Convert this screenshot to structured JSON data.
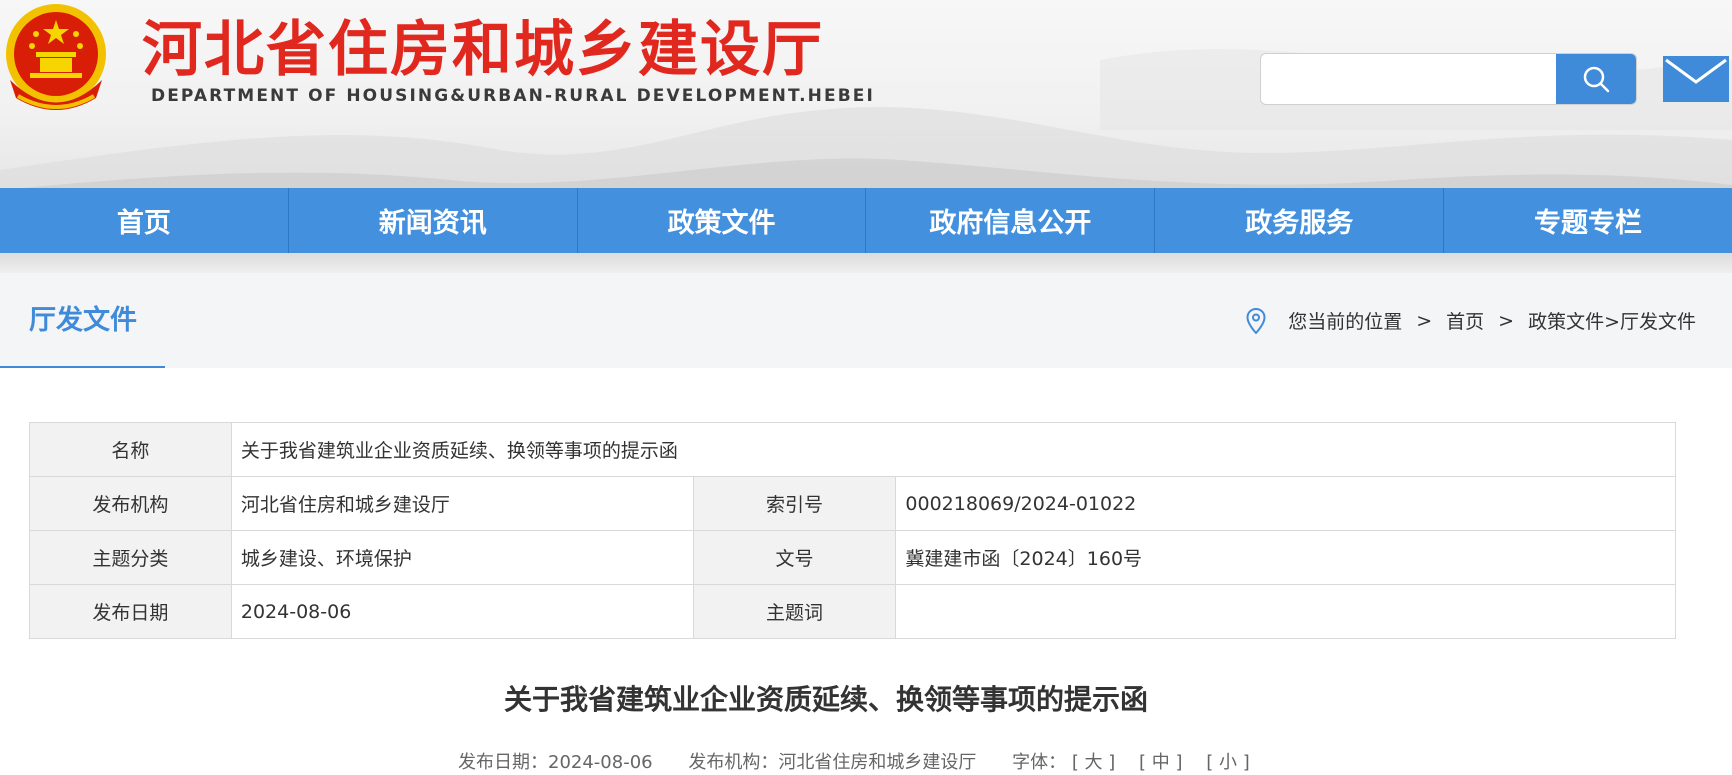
{
  "header": {
    "site_title": "河北省住房和城乡建设厅",
    "site_subtitle": "DEPARTMENT OF HOUSING&URBAN-RURAL DEVELOPMENT.HEBEI",
    "search_placeholder": "",
    "accent_color": "#e0281f",
    "nav_color": "#4390de"
  },
  "nav": {
    "items": [
      "首页",
      "新闻资讯",
      "政策文件",
      "政府信息公开",
      "政务服务",
      "专题专栏"
    ]
  },
  "location": {
    "section_title": "厅发文件",
    "prefix": "您当前的位置",
    "sep": ">",
    "crumb_home": "首页",
    "crumb_path": "政策文件>厅发文件"
  },
  "info": {
    "name_label": "名称",
    "name_value": "关于我省建筑业企业资质延续、换领等事项的提示函",
    "org_label": "发布机构",
    "org_value": "河北省住房和城乡建设厅",
    "index_label": "索引号",
    "index_value": "000218069/2024-01022",
    "topic_label": "主题分类",
    "topic_value": "城乡建设、环境保护",
    "docno_label": "文号",
    "docno_value": "冀建建市函〔2024〕160号",
    "date_label": "发布日期",
    "date_value": "2024-08-06",
    "keyword_label": "主题词",
    "keyword_value": ""
  },
  "article": {
    "title": "关于我省建筑业企业资质延续、换领等事项的提示函",
    "date_text": "发布日期：2024-08-06",
    "org_text": "发布机构：河北省住房和城乡建设厅",
    "font_label": "字体：",
    "font_large": "[ 大 ]",
    "font_medium": "[ 中 ]",
    "font_small": "[ 小 ]"
  }
}
